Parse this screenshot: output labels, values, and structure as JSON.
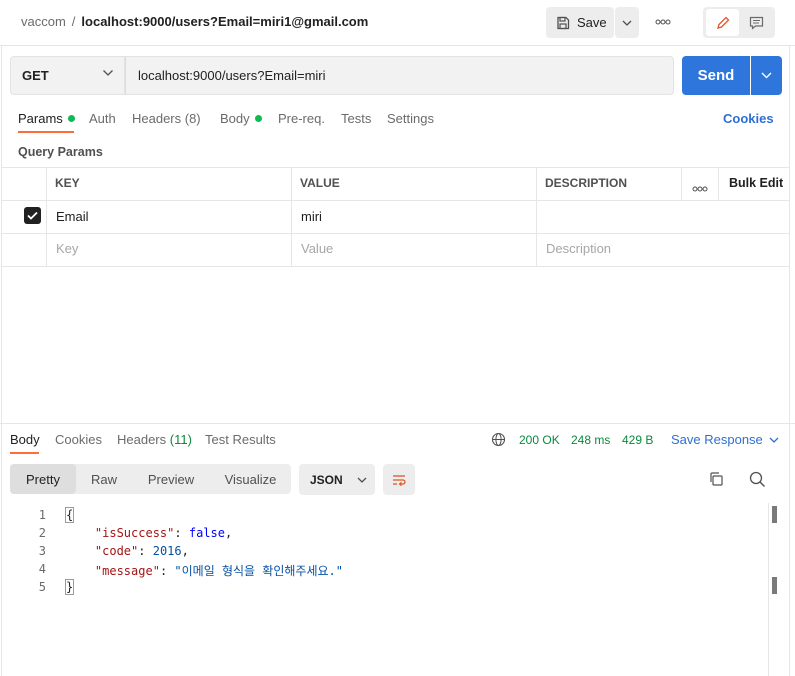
{
  "header": {
    "workspace": "vaccom",
    "separator": "/",
    "request_name": "localhost:9000/users?Email=miri1@gmail.com",
    "save_label": "Save"
  },
  "request": {
    "method": "GET",
    "url": "localhost:9000/users?Email=miri",
    "send_label": "Send"
  },
  "request_tabs": {
    "params": "Params",
    "auth": "Auth",
    "headers": "Headers (8)",
    "body": "Body",
    "prereq": "Pre-req.",
    "tests": "Tests",
    "settings": "Settings",
    "cookies": "Cookies"
  },
  "query_params": {
    "title": "Query Params",
    "columns": {
      "key": "KEY",
      "value": "VALUE",
      "description": "DESCRIPTION",
      "bulk_edit": "Bulk Edit"
    },
    "rows": [
      {
        "key": "Email",
        "value": "miri",
        "description": "",
        "checked": true
      }
    ],
    "placeholders": {
      "key": "Key",
      "value": "Value",
      "description": "Description"
    }
  },
  "response": {
    "tabs": {
      "body": "Body",
      "cookies": "Cookies",
      "headers": "Headers",
      "headers_count": "(11)",
      "test_results": "Test Results"
    },
    "status": "200 OK",
    "time": "248 ms",
    "size": "429 B",
    "save_response": "Save Response",
    "views": [
      "Pretty",
      "Raw",
      "Preview",
      "Visualize"
    ],
    "format": "JSON",
    "code": {
      "line_numbers": [
        "1",
        "2",
        "3",
        "4",
        "5"
      ],
      "open_brace": "{",
      "close_brace": "}",
      "k1": "\"isSuccess\"",
      "v1": "false",
      "k2": "\"code\"",
      "v2": "2016",
      "k3": "\"message\"",
      "v3": "\"이메일 형식을 확인해주세요.\""
    }
  },
  "colors": {
    "accent_orange": "#ff6c37",
    "send_blue": "#2e76db",
    "link_blue": "#2e6fd4",
    "status_green": "#0a8a3c",
    "dot_green": "#0cbb52"
  }
}
